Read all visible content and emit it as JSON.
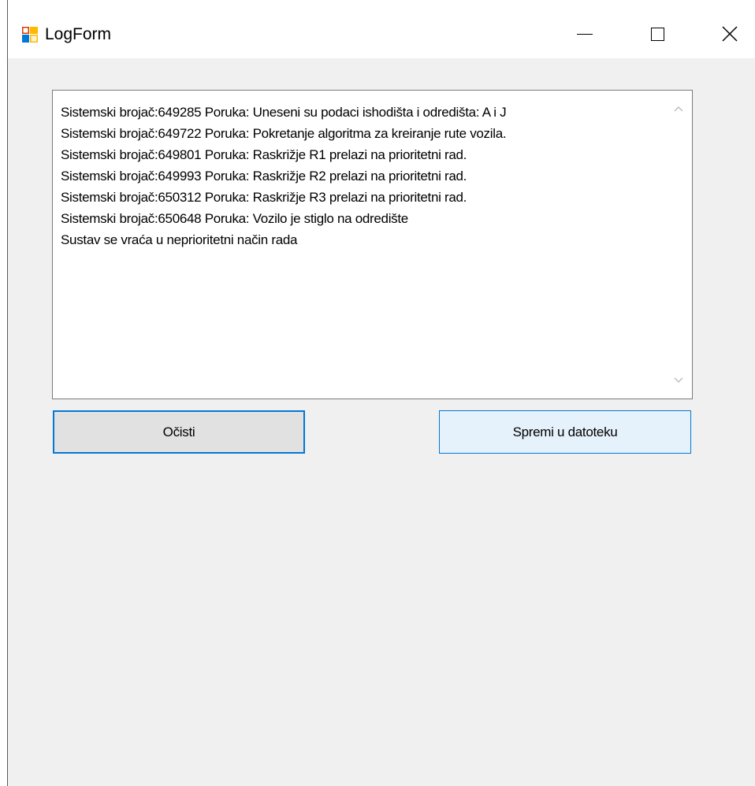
{
  "window": {
    "title": "LogForm",
    "icon": "winforms-app-icon",
    "controls": {
      "minimize": "minimize-icon",
      "maximize": "maximize-icon",
      "close": "close-icon"
    }
  },
  "log": {
    "lines": [
      "Sistemski brojač:649285 Poruka: Uneseni su podaci ishodišta i odredišta: A i J",
      "Sistemski brojač:649722 Poruka: Pokretanje algoritma za kreiranje rute vozila.",
      "Sistemski brojač:649801 Poruka: Raskrižje R1 prelazi na prioritetni rad.",
      "Sistemski brojač:649993 Poruka: Raskrižje R2 prelazi na prioritetni rad.",
      "Sistemski brojač:650312 Poruka: Raskrižje R3 prelazi na prioritetni rad.",
      "Sistemski brojač:650648 Poruka: Vozilo je stiglo na odredište",
      "Sustav se vraća u neprioritetni način rada"
    ]
  },
  "buttons": {
    "clear_label": "Očisti",
    "save_label": "Spremi u datoteku"
  },
  "colors": {
    "accent": "#0078d7",
    "window_bg": "#f0f0f0",
    "clear_bg": "#e1e1e1",
    "save_bg": "#e5f1fb"
  }
}
